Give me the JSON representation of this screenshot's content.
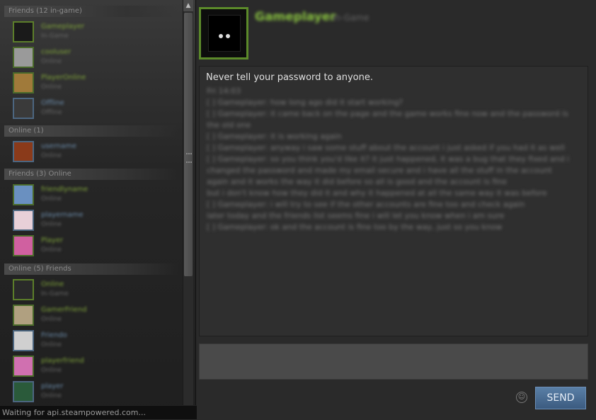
{
  "sidebar": {
    "groups": [
      {
        "label": "Friends (12 in-game)"
      },
      {
        "label": "Online (1)"
      },
      {
        "label": "Friends (3) Online"
      },
      {
        "label": "Online (5) Friends"
      }
    ],
    "friends": [
      {
        "name": "Gameplayer",
        "status": "In-Game",
        "avatar_bg": "#1a1a1a",
        "state": "ingame"
      },
      {
        "name": "cooluser",
        "status": "Online",
        "avatar_bg": "#9a9a9a",
        "state": "online"
      },
      {
        "name": "PlayerOnline",
        "status": "Online",
        "avatar_bg": "#a07a3a",
        "state": "online"
      },
      {
        "name": "Offline",
        "status": "Offline",
        "avatar_bg": "#3a3a3a",
        "state": "offline"
      },
      {
        "name": "username",
        "status": "Online",
        "avatar_bg": "#8a3a1a",
        "state": "offline"
      },
      {
        "name": "friendlyname",
        "status": "Online",
        "avatar_bg": "#6a90c0",
        "state": "online"
      },
      {
        "name": "playername",
        "status": "Online",
        "avatar_bg": "#e8d0d8",
        "state": "offline"
      },
      {
        "name": "Player",
        "status": "Online",
        "avatar_bg": "#d060a0",
        "state": "online"
      },
      {
        "name": "Online",
        "status": "In-Game",
        "avatar_bg": "#2a2a2a",
        "state": "ingame"
      },
      {
        "name": "GamerFriend",
        "status": "Online",
        "avatar_bg": "#b0a080",
        "state": "online"
      },
      {
        "name": "Friendo",
        "status": "Online",
        "avatar_bg": "#d0d0d0",
        "state": "offline"
      },
      {
        "name": "playerfriend",
        "status": "Online",
        "avatar_bg": "#d070b0",
        "state": "online"
      },
      {
        "name": "player",
        "status": "Online",
        "avatar_bg": "#2a5a3a",
        "state": "offline"
      }
    ],
    "status_bar": "Waiting for api.steampowered.com..."
  },
  "chat": {
    "name": "Gameplayer",
    "sub": "In-Game",
    "warning": "Never tell your password to anyone.",
    "messages": [
      "Fri 14:03",
      "[ ] Gameplayer: how long ago did it start working?",
      "[ ] Gameplayer: it came back on the page and the game works fine now and the password is the old one",
      "[ ] Gameplayer: it is working again",
      "[ ] Gameplayer: anyway i saw some stuff about the account i just asked if you had it as well",
      "[ ] Gameplayer: so you think you'd like it? it just happened, it was a bug that they fixed and i",
      "changed the password and made my email secure and i have all the stuff in the account",
      "again and it works the way it did before so all is good and the account is fine",
      "but i don't know how they did it and why it happened at all the same way it was before",
      "[ ] Gameplayer: i will try to see if the other accounts are fine too and check again",
      "later today and the friends list seems fine i will let you know when i am sure",
      "[ ] Gameplayer: ok and the account is fine too by the way, just so you know"
    ]
  },
  "send_label": "SEND",
  "emoticon_label": "☺"
}
